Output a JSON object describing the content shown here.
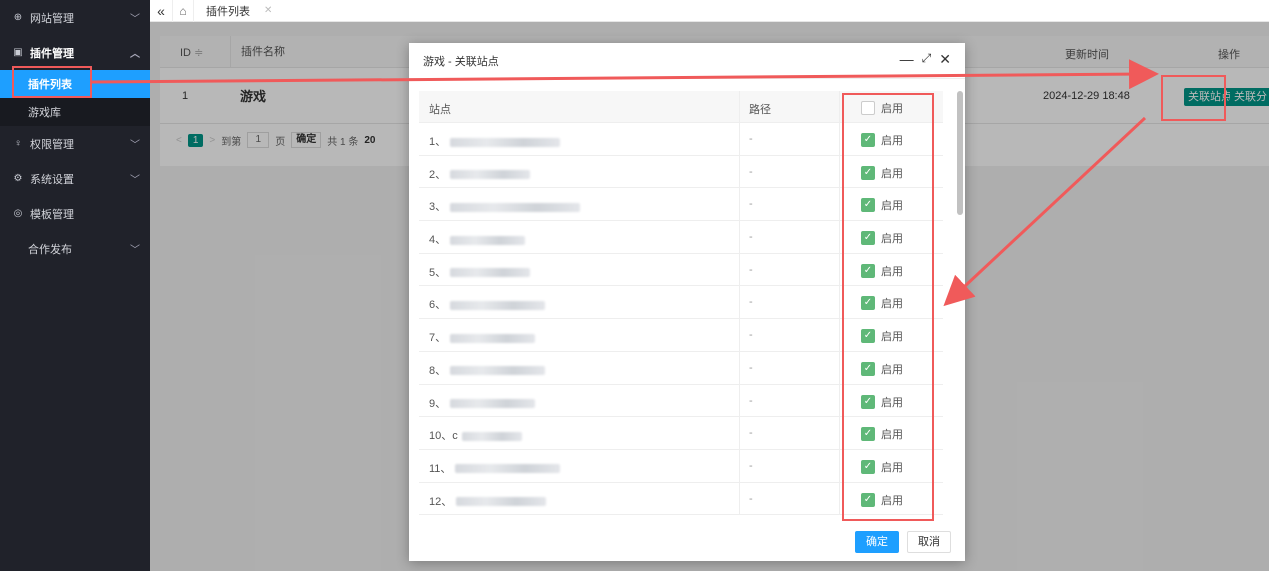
{
  "sidebar": {
    "items": [
      {
        "label": "网站管理",
        "icon": "globe-icon"
      },
      {
        "label": "插件管理",
        "icon": "plugin-icon"
      },
      {
        "label": "权限管理",
        "icon": "key-icon"
      },
      {
        "label": "系统设置",
        "icon": "gear-icon"
      },
      {
        "label": "模板管理",
        "icon": "palette-icon"
      },
      {
        "label": "合作发布"
      }
    ],
    "sub_items": [
      "插件列表",
      "游戏库"
    ]
  },
  "topbar": {
    "tab_label": "插件列表"
  },
  "table": {
    "headers": {
      "id": "ID",
      "name": "插件名称",
      "time": "更新时间",
      "op": "操作"
    },
    "row": {
      "id": "1",
      "name": "游戏",
      "time": "2024-12-29 18:48",
      "btn_site": "关联站点",
      "btn_cat": "关联分类"
    },
    "pager": {
      "prev": "<",
      "page": "1",
      "next": ">",
      "goto": "到第",
      "page_value": "1",
      "page_unit": "页",
      "ok": "确定",
      "total": "共 1 条",
      "size": "20"
    }
  },
  "modal": {
    "title": "游戏 - 关联站点",
    "headers": {
      "site": "站点",
      "path": "路径",
      "enable": "启用"
    },
    "rows": [
      {
        "site": "1、",
        "path": "-",
        "enable": "启用"
      },
      {
        "site": "2、",
        "path": "-",
        "enable": "启用"
      },
      {
        "site": "3、",
        "path": "-",
        "enable": "启用"
      },
      {
        "site": "4、",
        "path": "-",
        "enable": "启用"
      },
      {
        "site": "5、",
        "path": "-",
        "enable": "启用"
      },
      {
        "site": "6、",
        "path": "-",
        "enable": "启用"
      },
      {
        "site": "7、",
        "path": "-",
        "enable": "启用"
      },
      {
        "site": "8、",
        "path": "-",
        "enable": "启用"
      },
      {
        "site": "9、",
        "path": "-",
        "enable": "启用"
      },
      {
        "site": "10、c",
        "path": "-",
        "enable": "启用"
      },
      {
        "site": "11、",
        "path": "-",
        "enable": "启用"
      },
      {
        "site": "12、",
        "path": "-",
        "enable": "启用"
      }
    ],
    "confirm": "确定",
    "cancel": "取消"
  },
  "colors": {
    "accent": "#009688",
    "primary": "#1e9fff",
    "annotation": "#f05a5a",
    "checkbox": "#5fb878"
  }
}
